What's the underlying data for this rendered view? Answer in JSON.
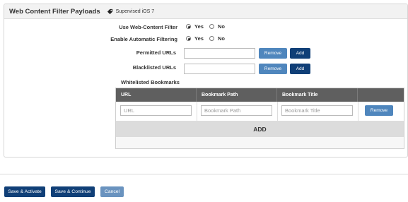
{
  "panel": {
    "title": "Web Content Filter Payloads",
    "tag_icon": "tag-icon",
    "subtitle": "Supervised iOS 7"
  },
  "form": {
    "web_content_filter": {
      "label": "Use Web-Content Filter",
      "options": [
        "Yes",
        "No"
      ],
      "selected": "Yes"
    },
    "automatic_filtering": {
      "label": "Enable Automatic Filtering",
      "options": [
        "Yes",
        "No"
      ],
      "selected": "Yes"
    },
    "permitted_urls": {
      "label": "Permitted URLs",
      "value": "",
      "remove_label": "Remove",
      "add_label": "Add"
    },
    "blacklisted_urls": {
      "label": "Blacklisted URLs",
      "value": "",
      "remove_label": "Remove",
      "add_label": "Add"
    },
    "whitelisted_bookmarks": {
      "label": "Whitelisted Bookmarks"
    }
  },
  "bookmarks_table": {
    "columns": [
      "URL",
      "Bookmark Path",
      "Bookmark Title",
      ""
    ],
    "row": {
      "url_placeholder": "URL",
      "path_placeholder": "Bookmark Path",
      "title_placeholder": "Bookmark Title",
      "remove_label": "Remove"
    },
    "add_label": "ADD"
  },
  "footer": {
    "save_activate": "Save & Activate",
    "save_continue": "Save & Continue",
    "cancel": "Cancel"
  },
  "colors": {
    "primary_dark": "#103f77",
    "primary_light": "#4f86bd",
    "header_dark": "#5f5f5f"
  }
}
